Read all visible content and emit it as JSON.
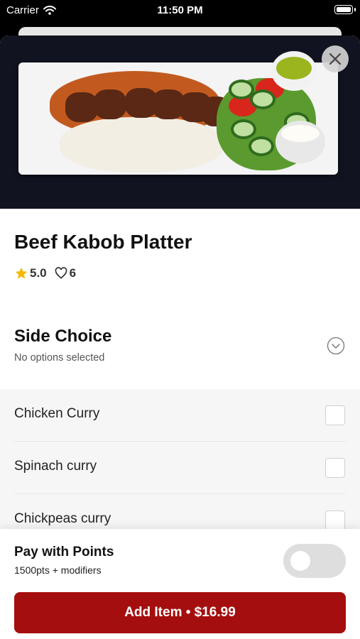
{
  "status_bar": {
    "carrier": "Carrier",
    "time": "11:50 PM"
  },
  "item": {
    "title": "Beef Kabob Platter",
    "rating": "5.0",
    "likes": "6"
  },
  "side_choice": {
    "title": "Side Choice",
    "subtitle": "No options selected",
    "options": [
      {
        "label": "Chicken Curry"
      },
      {
        "label": "Spinach curry"
      },
      {
        "label": "Chickpeas curry"
      }
    ]
  },
  "points": {
    "title": "Pay with Points",
    "subtitle": "1500pts + modifiers",
    "enabled": false
  },
  "add_button": {
    "label": "Add Item • $16.99"
  },
  "colors": {
    "accent": "#a50e0e",
    "star": "#f5b800"
  }
}
